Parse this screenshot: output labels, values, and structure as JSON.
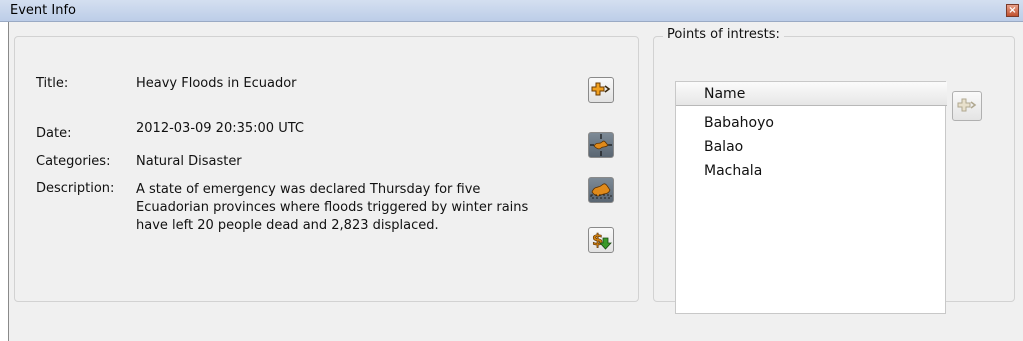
{
  "window": {
    "title": "Event Info"
  },
  "event": {
    "title_label": "Title:",
    "title_value": "Heavy Floods in Ecuador",
    "date_label": "Date:",
    "date_value": "2012-03-09 20:35:00 UTC",
    "categories_label": "Categories:",
    "categories_value": "Natural Disaster",
    "description_label": "Description:",
    "description_value": "A state of emergency was declared Thursday for five Ecuadorian provinces where floods triggered by winter rains have left 20 people dead and 2,823 displaced."
  },
  "toolbar": {
    "buttons": [
      {
        "icon": "add-to-map-icon"
      },
      {
        "icon": "zoom-to-event-icon"
      },
      {
        "icon": "show-area-icon"
      },
      {
        "icon": "financial-download-icon"
      }
    ]
  },
  "poi": {
    "group_label": "Points of intrests:",
    "column_header": "Name",
    "items": [
      "Babahoyo",
      "Balao",
      "Machala"
    ],
    "add_icon": "add-poi-icon"
  },
  "colors": {
    "titlebar": "#c8d6ee",
    "accent_orange": "#e08a1a",
    "panel_bg": "#f0f0f0"
  }
}
